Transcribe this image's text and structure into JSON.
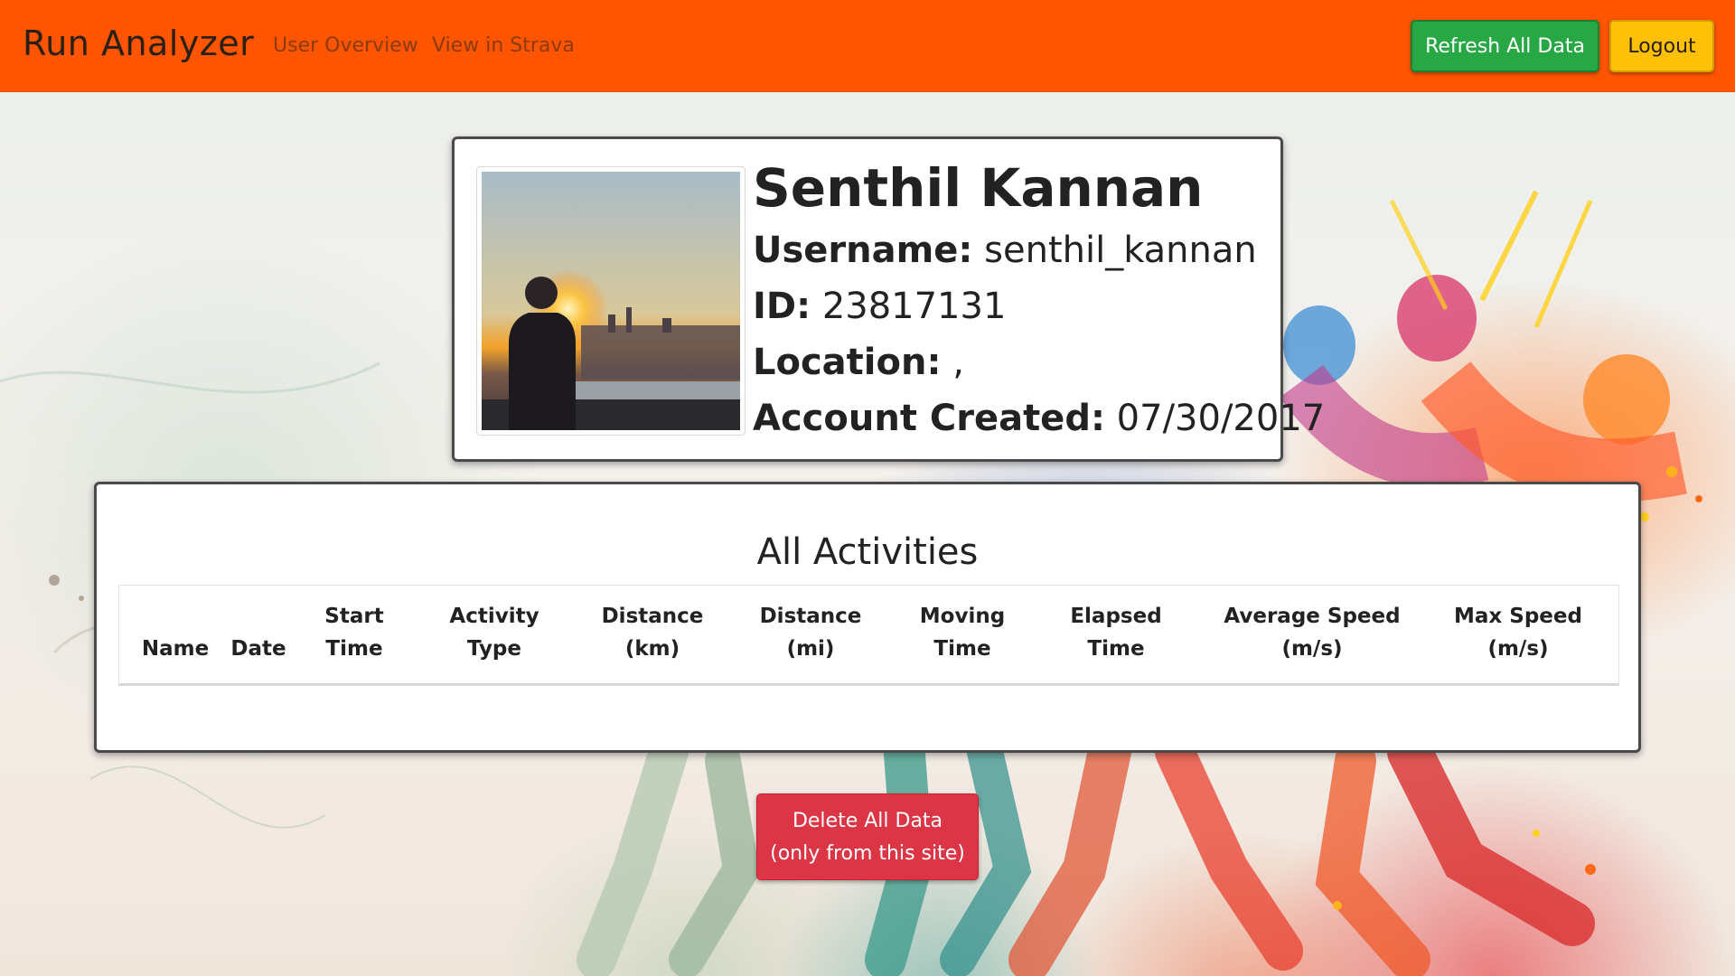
{
  "navbar": {
    "brand": "Run Analyzer",
    "links": [
      "User Overview",
      "View in Strava"
    ],
    "refresh_label": "Refresh All Data",
    "logout_label": "Logout"
  },
  "profile": {
    "name": "Senthil Kannan",
    "username_label": "Username:",
    "username": "senthil_kannan",
    "id_label": "ID:",
    "id": "23817131",
    "location_label": "Location:",
    "location": ",",
    "created_label": "Account Created:",
    "created": "07/30/2017"
  },
  "activities": {
    "title": "All Activities",
    "columns": [
      {
        "line1": "",
        "line2": "Name"
      },
      {
        "line1": "",
        "line2": "Date"
      },
      {
        "line1": "Start",
        "line2": "Time"
      },
      {
        "line1": "Activity",
        "line2": "Type"
      },
      {
        "line1": "Distance",
        "line2": "(km)"
      },
      {
        "line1": "Distance",
        "line2": "(mi)"
      },
      {
        "line1": "Moving",
        "line2": "Time"
      },
      {
        "line1": "Elapsed",
        "line2": "Time"
      },
      {
        "line1": "Average Speed",
        "line2": "(m/s)"
      },
      {
        "line1": "Max Speed",
        "line2": "(m/s)"
      }
    ],
    "rows": []
  },
  "delete_button": {
    "line1": "Delete All Data",
    "line2": "(only from this site)"
  },
  "colors": {
    "navbar": "#ff5500",
    "refresh": "#28a745",
    "logout": "#ffc107",
    "delete": "#dc3545"
  }
}
